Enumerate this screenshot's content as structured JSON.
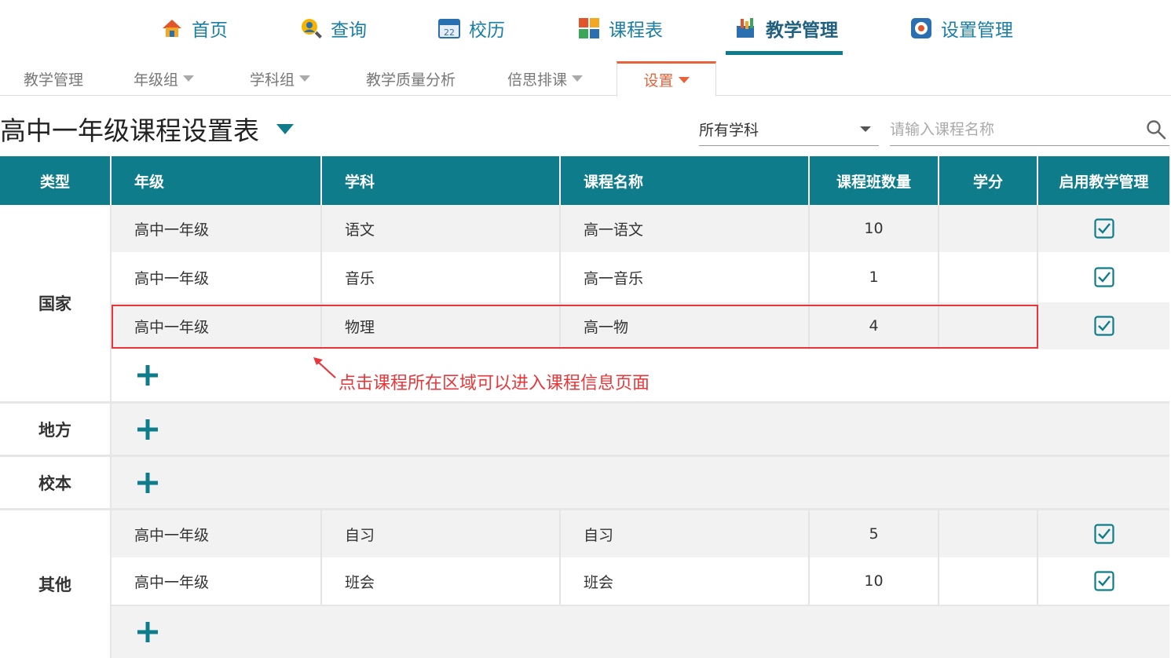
{
  "topnav": {
    "items": [
      {
        "label": "首页",
        "icon": "home-icon"
      },
      {
        "label": "查询",
        "icon": "search-person-icon"
      },
      {
        "label": "校历",
        "icon": "calendar-icon"
      },
      {
        "label": "课程表",
        "icon": "timetable-icon"
      },
      {
        "label": "教学管理",
        "icon": "teaching-icon"
      },
      {
        "label": "设置管理",
        "icon": "settings-icon"
      }
    ],
    "active": "教学管理",
    "calendar_day": "22"
  },
  "subnav": {
    "items": [
      {
        "label": "教学管理",
        "dropdown": false
      },
      {
        "label": "年级组",
        "dropdown": true
      },
      {
        "label": "学科组",
        "dropdown": true
      },
      {
        "label": "教学质量分析",
        "dropdown": false
      },
      {
        "label": "倍思排课",
        "dropdown": true
      },
      {
        "label": "设置",
        "dropdown": true
      }
    ],
    "active": "设置"
  },
  "page": {
    "title": "高中一年级课程设置表",
    "subject_filter": "所有学科",
    "search_placeholder": "请输入课程名称"
  },
  "table": {
    "headers": [
      "类型",
      "年级",
      "学科",
      "课程名称",
      "课程班数量",
      "学分",
      "启用教学管理"
    ],
    "groups": [
      {
        "type": "国家",
        "rows": [
          {
            "grade": "高中一年级",
            "subject": "语文",
            "course": "高一语文",
            "classes": "10",
            "credit": "",
            "enabled": true
          },
          {
            "grade": "高中一年级",
            "subject": "音乐",
            "course": "高一音乐",
            "classes": "1",
            "credit": "",
            "enabled": true
          },
          {
            "grade": "高中一年级",
            "subject": "物理",
            "course": "高一物",
            "classes": "4",
            "credit": "",
            "enabled": true
          }
        ]
      },
      {
        "type": "地方",
        "rows": []
      },
      {
        "type": "校本",
        "rows": []
      },
      {
        "type": "其他",
        "rows": [
          {
            "grade": "高中一年级",
            "subject": "自习",
            "course": "自习",
            "classes": "5",
            "credit": "",
            "enabled": true
          },
          {
            "grade": "高中一年级",
            "subject": "班会",
            "course": "班会",
            "classes": "10",
            "credit": "",
            "enabled": true
          }
        ]
      }
    ]
  },
  "annotation": {
    "text": "点击课程所在区域可以进入课程信息页面",
    "color": "#e8373a"
  },
  "colors": {
    "header_bg": "#0e7c8a",
    "active_sub": "#e8623a",
    "nav_text": "#1a7fa6"
  }
}
